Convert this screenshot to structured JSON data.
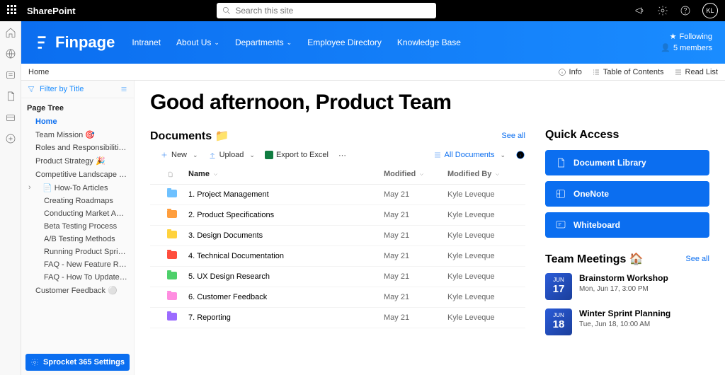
{
  "topbar": {
    "brand": "SharePoint",
    "search_placeholder": "Search this site",
    "avatar": "KL"
  },
  "header": {
    "logo": "Finpage",
    "nav": [
      "Intranet",
      "About Us",
      "Departments",
      "Employee Directory",
      "Knowledge Base"
    ],
    "following": "Following",
    "members": "5 members"
  },
  "crumb": {
    "label": "Home",
    "info": "Info",
    "toc": "Table of Contents",
    "readlist": "Read List"
  },
  "sidebar": {
    "filter": "Filter by Title",
    "treehdr": "Page Tree",
    "items": [
      {
        "label": "Home",
        "lvl": 0,
        "active": true
      },
      {
        "label": "Team Mission 🎯",
        "lvl": 0
      },
      {
        "label": "Roles and Responsibilities …",
        "lvl": 0
      },
      {
        "label": "Product Strategy 🎉",
        "lvl": 0
      },
      {
        "label": "Competitive Landscape 🖼️",
        "lvl": 0
      },
      {
        "label": "📄 How-To Articles",
        "lvl": 0,
        "how": true
      },
      {
        "label": "Creating Roadmaps",
        "lvl": 1
      },
      {
        "label": "Conducting Market Anal…",
        "lvl": 1
      },
      {
        "label": "Beta Testing Process",
        "lvl": 1
      },
      {
        "label": "A/B Testing Methods",
        "lvl": 1
      },
      {
        "label": "Running Product Sprints",
        "lvl": 1
      },
      {
        "label": "FAQ - New Feature Req…",
        "lvl": 1
      },
      {
        "label": "FAQ - How To Update D…",
        "lvl": 1
      },
      {
        "label": "Customer Feedback ⚪",
        "lvl": 0
      }
    ],
    "sprocket": "Sprocket 365 Settings"
  },
  "main": {
    "greet": "Good afternoon, Product Team",
    "docs_title": "Documents 📁",
    "seeall": "See all",
    "toolbar": {
      "new": "New",
      "upload": "Upload",
      "export": "Export to Excel",
      "view": "All Documents"
    },
    "columns": {
      "name": "Name",
      "mod": "Modified",
      "by": "Modified By"
    },
    "docs": [
      {
        "name": "1. Project Management",
        "mod": "May 21",
        "by": "Kyle Leveque",
        "color": "#6ec1ff"
      },
      {
        "name": "2. Product Specifications",
        "mod": "May 21",
        "by": "Kyle Leveque",
        "color": "#ff9e3d"
      },
      {
        "name": "3. Design Documents",
        "mod": "May 21",
        "by": "Kyle Leveque",
        "color": "#ffd23d"
      },
      {
        "name": "4. Technical Documentation",
        "mod": "May 21",
        "by": "Kyle Leveque",
        "color": "#ff4d3d"
      },
      {
        "name": "5. UX Design Research",
        "mod": "May 21",
        "by": "Kyle Leveque",
        "color": "#4dd06a"
      },
      {
        "name": "6. Customer Feedback",
        "mod": "May 21",
        "by": "Kyle Leveque",
        "color": "#ff8de0"
      },
      {
        "name": "7. Reporting",
        "mod": "May 21",
        "by": "Kyle Leveque",
        "color": "#9b6bff"
      }
    ],
    "qa_title": "Quick Access",
    "qa": [
      {
        "label": "Document Library"
      },
      {
        "label": "OneNote"
      },
      {
        "label": "Whiteboard"
      }
    ],
    "meet_title": "Team Meetings 🏠",
    "meetings": [
      {
        "mon": "JUN",
        "day": "17",
        "title": "Brainstorm Workshop",
        "sub": "Mon, Jun 17, 3:00 PM"
      },
      {
        "mon": "JUN",
        "day": "18",
        "title": "Winter Sprint Planning",
        "sub": "Tue, Jun 18, 10:00 AM"
      }
    ]
  }
}
